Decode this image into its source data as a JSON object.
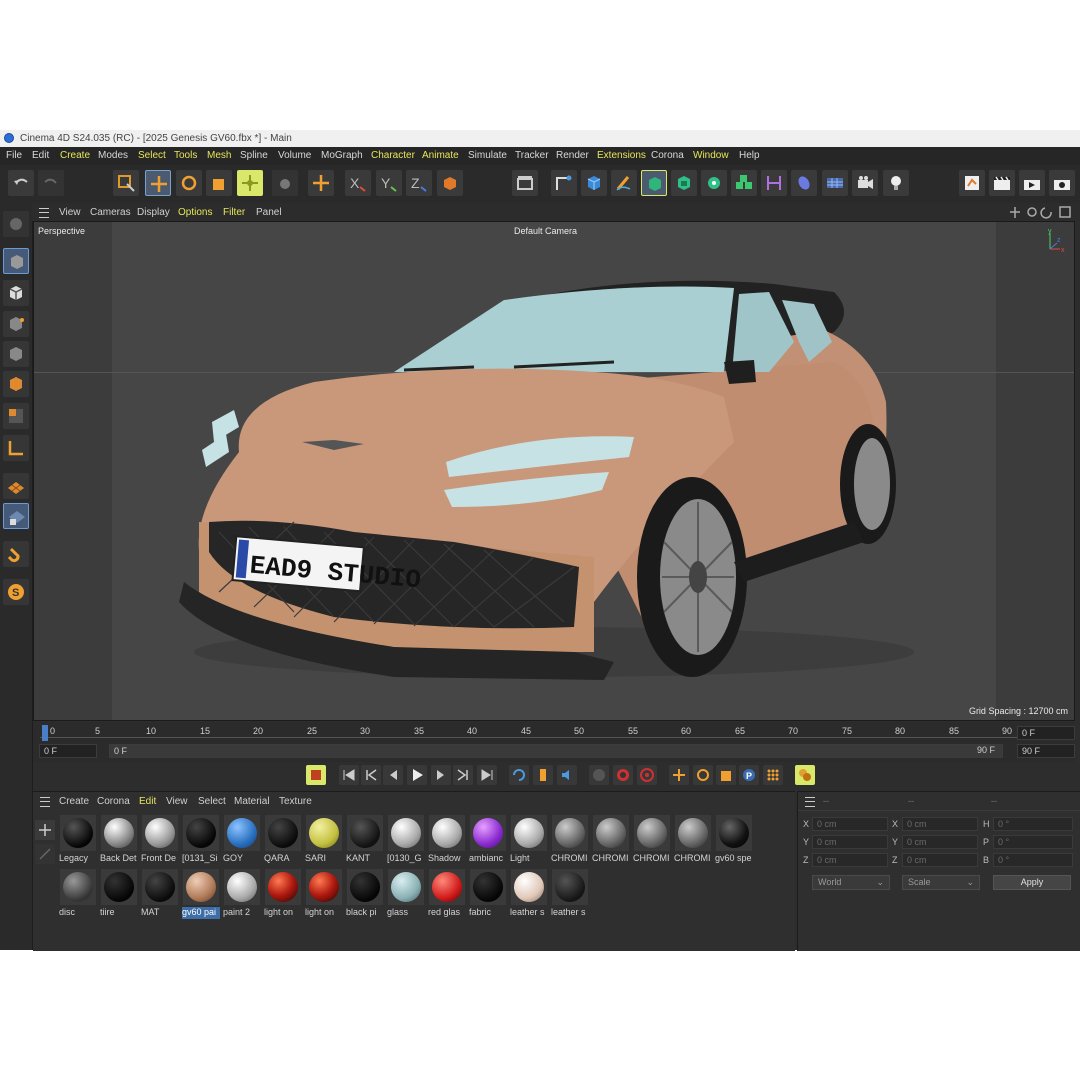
{
  "window": {
    "title": "Cinema 4D S24.035 (RC) - [2025 Genesis GV60.fbx *] - Main"
  },
  "menu": [
    "File",
    "Edit",
    "Create",
    "Modes",
    "Select",
    "Tools",
    "Mesh",
    "Spline",
    "Volume",
    "MoGraph",
    "Character",
    "Animate",
    "Simulate",
    "Tracker",
    "Render",
    "Extensions",
    "Corona",
    "Window",
    "Help"
  ],
  "viewport_menu": [
    "View",
    "Cameras",
    "Display",
    "Options",
    "Filter",
    "Panel"
  ],
  "viewport": {
    "name": "Perspective",
    "camera": "Default Camera",
    "grid_spacing": "Grid Spacing : 12700 cm",
    "license_plate": "EAD9 STUDIO"
  },
  "timeline": {
    "ticks": [
      "0",
      "5",
      "10",
      "15",
      "20",
      "25",
      "30",
      "35",
      "40",
      "45",
      "50",
      "55",
      "60",
      "65",
      "70",
      "75",
      "80",
      "85",
      "90"
    ],
    "start_frame": "0 F",
    "current_frame": "0 F",
    "end_frame_left": "90 F",
    "end_frame_right": "90 F",
    "max_frame": "0 F"
  },
  "material_menu": [
    "Create",
    "Corona",
    "Edit",
    "View",
    "Select",
    "Material",
    "Texture"
  ],
  "materials_row1": [
    "Legacy",
    "Back Det",
    "Front De",
    "[0131_Si",
    "GOY",
    "QARA",
    "SARI",
    "KANT",
    "[0130_G",
    "Shadow",
    "ambianc",
    "Light",
    "CHROMI",
    "CHROMI",
    "CHROMI",
    "CHROMI",
    "gv60 spe"
  ],
  "materials_row2": [
    "disc",
    "tiire",
    "MAT",
    "gv60 pai",
    "paint 2",
    "light on",
    "light on",
    "black pi",
    "glass",
    "red glas",
    "fabric",
    "leather s",
    "leather s"
  ],
  "attributes": {
    "header": [
      "--",
      "--",
      "--"
    ],
    "rows": [
      {
        "a": "X",
        "av": "0 cm",
        "b": "X",
        "bv": "0 cm",
        "c": "H",
        "cv": "0 °"
      },
      {
        "a": "Y",
        "av": "0 cm",
        "b": "Y",
        "bv": "0 cm",
        "c": "P",
        "cv": "0 °"
      },
      {
        "a": "Z",
        "av": "0 cm",
        "b": "Z",
        "bv": "0 cm",
        "c": "B",
        "cv": "0 °"
      }
    ],
    "coord_mode": "World",
    "size_mode": "Scale",
    "apply": "Apply"
  },
  "colors": {
    "accent": "#e6e65a",
    "selection": "#3d6ea8",
    "car_body": "#c9977a",
    "glass": "#a9cfd3"
  }
}
